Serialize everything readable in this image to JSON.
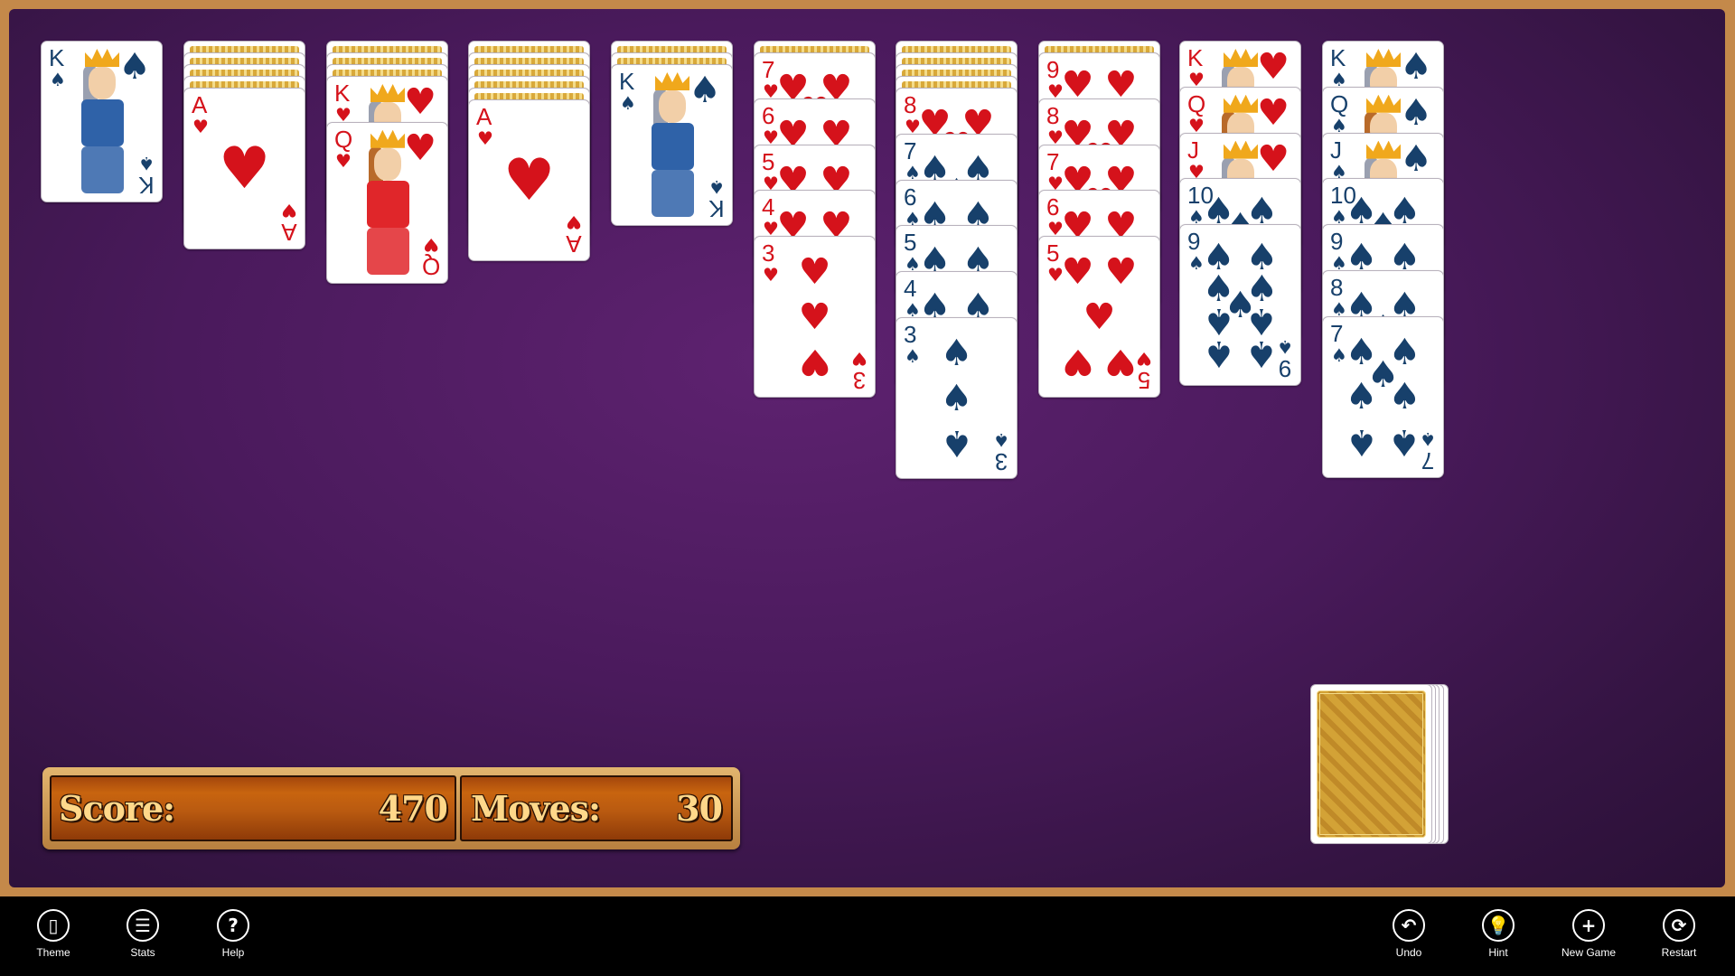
{
  "game": "Klondike Solitaire",
  "colors": {
    "frame": "#c4894a",
    "felt": "#4a1a5c",
    "red_suit": "#d5121b",
    "black_suit": "#17406b",
    "toolbar": "#000000"
  },
  "tableau": [
    {
      "facedown": 0,
      "cards": [
        {
          "rank": "K",
          "suit": "spades"
        }
      ]
    },
    {
      "facedown": 4,
      "cards": [
        {
          "rank": "A",
          "suit": "hearts"
        }
      ]
    },
    {
      "facedown": 3,
      "cards": [
        {
          "rank": "K",
          "suit": "hearts"
        },
        {
          "rank": "Q",
          "suit": "hearts"
        }
      ]
    },
    {
      "facedown": 5,
      "cards": [
        {
          "rank": "A",
          "suit": "hearts"
        }
      ]
    },
    {
      "facedown": 2,
      "cards": [
        {
          "rank": "K",
          "suit": "spades"
        }
      ]
    },
    {
      "facedown": 1,
      "cards": [
        {
          "rank": "7",
          "suit": "hearts"
        },
        {
          "rank": "6",
          "suit": "hearts"
        },
        {
          "rank": "5",
          "suit": "hearts"
        },
        {
          "rank": "4",
          "suit": "hearts"
        },
        {
          "rank": "3",
          "suit": "hearts"
        }
      ]
    },
    {
      "facedown": 4,
      "cards": [
        {
          "rank": "8",
          "suit": "hearts"
        },
        {
          "rank": "7",
          "suit": "spades"
        },
        {
          "rank": "6",
          "suit": "spades"
        },
        {
          "rank": "5",
          "suit": "spades"
        },
        {
          "rank": "4",
          "suit": "spades"
        },
        {
          "rank": "3",
          "suit": "spades"
        }
      ]
    },
    {
      "facedown": 1,
      "cards": [
        {
          "rank": "9",
          "suit": "hearts"
        },
        {
          "rank": "8",
          "suit": "hearts"
        },
        {
          "rank": "7",
          "suit": "hearts"
        },
        {
          "rank": "6",
          "suit": "hearts"
        },
        {
          "rank": "5",
          "suit": "hearts"
        }
      ]
    },
    {
      "facedown": 0,
      "cards": [
        {
          "rank": "K",
          "suit": "hearts"
        },
        {
          "rank": "Q",
          "suit": "hearts"
        },
        {
          "rank": "J",
          "suit": "hearts"
        },
        {
          "rank": "10",
          "suit": "spades"
        },
        {
          "rank": "9",
          "suit": "spades"
        }
      ]
    },
    {
      "facedown": 0,
      "cards": [
        {
          "rank": "K",
          "suit": "spades"
        },
        {
          "rank": "Q",
          "suit": "spades"
        },
        {
          "rank": "J",
          "suit": "spades"
        },
        {
          "rank": "10",
          "suit": "spades"
        },
        {
          "rank": "9",
          "suit": "spades"
        },
        {
          "rank": "8",
          "suit": "spades"
        },
        {
          "rank": "7",
          "suit": "spades"
        }
      ]
    }
  ],
  "stock": {
    "icon": "card-back-pattern"
  },
  "score": {
    "score_label": "Score:",
    "score_value": "470",
    "moves_label": "Moves:",
    "moves_value": "30"
  },
  "toolbar": {
    "left": [
      {
        "label": "Theme",
        "icon": "theme-icon",
        "glyph": "▯"
      },
      {
        "label": "Stats",
        "icon": "stats-icon",
        "glyph": "☰"
      },
      {
        "label": "Help",
        "icon": "help-icon",
        "glyph": "?"
      }
    ],
    "right": [
      {
        "label": "Undo",
        "icon": "undo-icon",
        "glyph": "↶"
      },
      {
        "label": "Hint",
        "icon": "hint-icon",
        "glyph": "💡"
      },
      {
        "label": "New Game",
        "icon": "new-game-icon",
        "glyph": "+"
      },
      {
        "label": "Restart",
        "icon": "restart-icon",
        "glyph": "⟳"
      }
    ]
  }
}
